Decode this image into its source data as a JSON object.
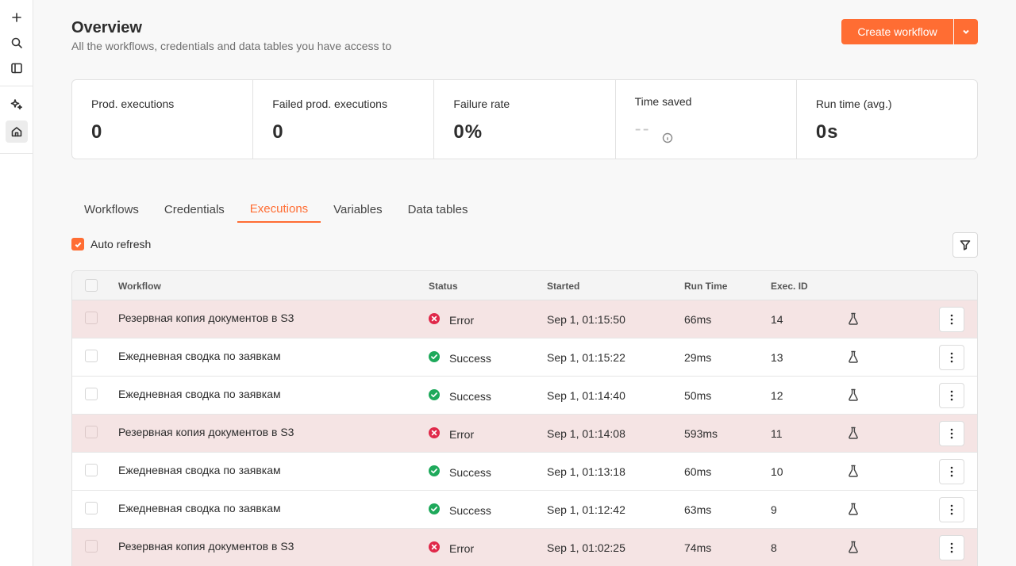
{
  "header": {
    "title": "Overview",
    "subtitle": "All the workflows, credentials and data tables you have access to",
    "create_label": "Create workflow"
  },
  "rail": {
    "icons": [
      "plus-icon",
      "search-icon",
      "sidebar-toggle-icon",
      "sparkles-icon",
      "home-icon"
    ]
  },
  "stats": [
    {
      "label": "Prod. executions",
      "value": "0"
    },
    {
      "label": "Failed prod. executions",
      "value": "0"
    },
    {
      "label": "Failure rate",
      "value": "0%"
    },
    {
      "label": "Time saved",
      "value": "--"
    },
    {
      "label": "Run time (avg.)",
      "value": "0s"
    }
  ],
  "tabs": [
    {
      "label": "Workflows"
    },
    {
      "label": "Credentials"
    },
    {
      "label": "Executions",
      "active": true
    },
    {
      "label": "Variables"
    },
    {
      "label": "Data tables"
    }
  ],
  "auto_refresh": {
    "label": "Auto refresh",
    "checked": true
  },
  "table": {
    "columns": {
      "workflow": "Workflow",
      "status": "Status",
      "started": "Started",
      "runtime": "Run Time",
      "execid": "Exec. ID"
    },
    "rows": [
      {
        "workflow": "Резервная копия документов в S3",
        "status": "Error",
        "started": "Sep 1, 01:15:50",
        "runtime": "66ms",
        "execid": "14"
      },
      {
        "workflow": "Ежедневная сводка по заявкам",
        "status": "Success",
        "started": "Sep 1, 01:15:22",
        "runtime": "29ms",
        "execid": "13"
      },
      {
        "workflow": "Ежедневная сводка по заявкам",
        "status": "Success",
        "started": "Sep 1, 01:14:40",
        "runtime": "50ms",
        "execid": "12"
      },
      {
        "workflow": "Резервная копия документов в S3",
        "status": "Error",
        "started": "Sep 1, 01:14:08",
        "runtime": "593ms",
        "execid": "11"
      },
      {
        "workflow": "Ежедневная сводка по заявкам",
        "status": "Success",
        "started": "Sep 1, 01:13:18",
        "runtime": "60ms",
        "execid": "10"
      },
      {
        "workflow": "Ежедневная сводка по заявкам",
        "status": "Success",
        "started": "Sep 1, 01:12:42",
        "runtime": "63ms",
        "execid": "9"
      },
      {
        "workflow": "Резервная копия документов в S3",
        "status": "Error",
        "started": "Sep 1, 01:02:25",
        "runtime": "74ms",
        "execid": "8"
      }
    ]
  },
  "colors": {
    "accent": "#ff6d33",
    "error": "#e0294a",
    "success": "#1ea95b",
    "error_row_bg": "#f5e4e4"
  }
}
